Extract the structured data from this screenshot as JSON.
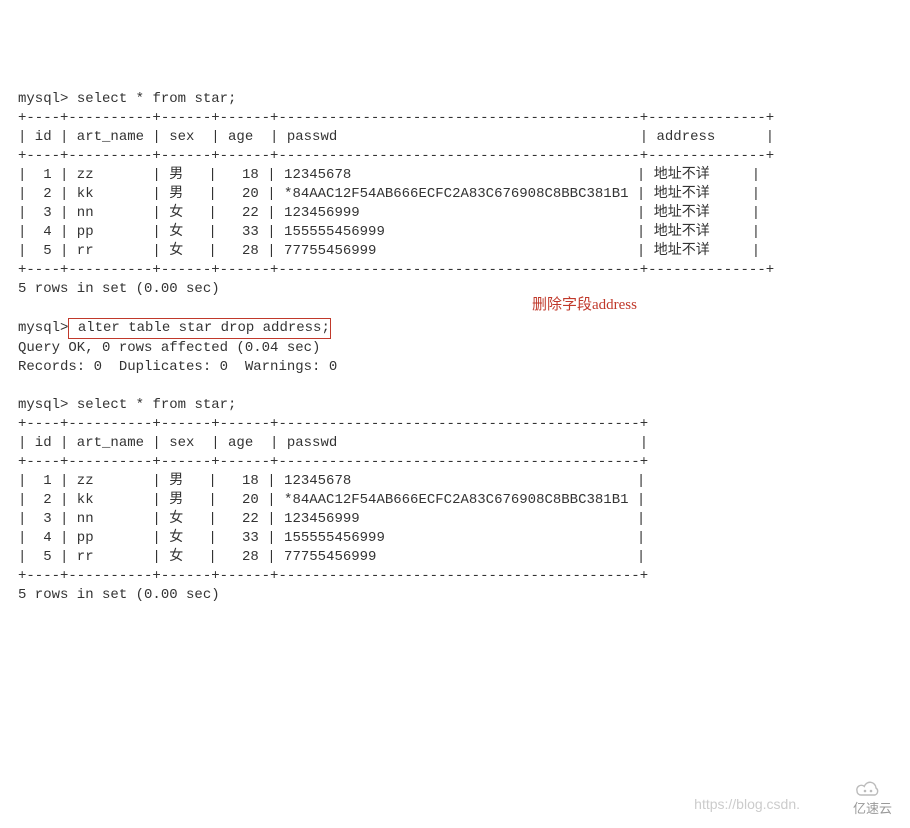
{
  "query1": {
    "prompt": "mysql>",
    "select": "select * from star;",
    "headers": [
      "id",
      "art_name",
      "sex",
      "age",
      "passwd",
      "address"
    ],
    "border_top": "+----+----------+------+------+-------------------------------------------+--------------+",
    "header_line": "| id | art_name | sex  | age  | passwd                                    | address      |",
    "border_mid": "+----+----------+------+------+-------------------------------------------+--------------+",
    "rows": [
      "|  1 | zz       | 男   |   18 | 12345678                                  | 地址不详     |",
      "|  2 | kk       | 男   |   20 | *84AAC12F54AB666ECFC2A83C676908C8BBC381B1 | 地址不详     |",
      "|  3 | nn       | 女   |   22 | 123456999                                 | 地址不详     |",
      "|  4 | pp       | 女   |   33 | 155555456999                              | 地址不详     |",
      "|  5 | rr       | 女   |   28 | 77755456999                               | 地址不详     |"
    ],
    "border_bot": "+----+----------+------+------+-------------------------------------------+--------------+",
    "footer": "5 rows in set (0.00 sec)"
  },
  "alter": {
    "prompt": "mysql>",
    "stmt_pre": " alter table star drop address;",
    "result1": "Query OK, 0 rows affected (0.04 sec)",
    "result2": "Records: 0  Duplicates: 0  Warnings: 0"
  },
  "annotation": {
    "text": "删除字段address"
  },
  "query2": {
    "prompt": "mysql>",
    "select": "select * from star;",
    "headers": [
      "id",
      "art_name",
      "sex",
      "age",
      "passwd"
    ],
    "border_top": "+----+----------+------+------+-------------------------------------------+",
    "header_line": "| id | art_name | sex  | age  | passwd                                    |",
    "border_mid": "+----+----------+------+------+-------------------------------------------+",
    "rows": [
      "|  1 | zz       | 男   |   18 | 12345678                                  |",
      "|  2 | kk       | 男   |   20 | *84AAC12F54AB666ECFC2A83C676908C8BBC381B1 |",
      "|  3 | nn       | 女   |   22 | 123456999                                 |",
      "|  4 | pp       | 女   |   33 | 155555456999                              |",
      "|  5 | rr       | 女   |   28 | 77755456999                               |"
    ],
    "border_bot": "+----+----------+------+------+-------------------------------------------+",
    "footer": "5 rows in set (0.00 sec)"
  },
  "watermark": {
    "text": "https://blog.csdn."
  },
  "logo": {
    "text": "亿速云"
  },
  "chart_data": {
    "type": "table",
    "title": "star table before and after dropping address column",
    "before": {
      "columns": [
        "id",
        "art_name",
        "sex",
        "age",
        "passwd",
        "address"
      ],
      "rows": [
        {
          "id": 1,
          "art_name": "zz",
          "sex": "男",
          "age": 18,
          "passwd": "12345678",
          "address": "地址不详"
        },
        {
          "id": 2,
          "art_name": "kk",
          "sex": "男",
          "age": 20,
          "passwd": "*84AAC12F54AB666ECFC2A83C676908C8BBC381B1",
          "address": "地址不详"
        },
        {
          "id": 3,
          "art_name": "nn",
          "sex": "女",
          "age": 22,
          "passwd": "123456999",
          "address": "地址不详"
        },
        {
          "id": 4,
          "art_name": "pp",
          "sex": "女",
          "age": 33,
          "passwd": "155555456999",
          "address": "地址不详"
        },
        {
          "id": 5,
          "art_name": "rr",
          "sex": "女",
          "age": 28,
          "passwd": "77755456999",
          "address": "地址不详"
        }
      ]
    },
    "ddl": "alter table star drop address;",
    "after": {
      "columns": [
        "id",
        "art_name",
        "sex",
        "age",
        "passwd"
      ],
      "rows": [
        {
          "id": 1,
          "art_name": "zz",
          "sex": "男",
          "age": 18,
          "passwd": "12345678"
        },
        {
          "id": 2,
          "art_name": "kk",
          "sex": "男",
          "age": 20,
          "passwd": "*84AAC12F54AB666ECFC2A83C676908C8BBC381B1"
        },
        {
          "id": 3,
          "art_name": "nn",
          "sex": "女",
          "age": 22,
          "passwd": "123456999"
        },
        {
          "id": 4,
          "art_name": "pp",
          "sex": "女",
          "age": 33,
          "passwd": "155555456999"
        },
        {
          "id": 5,
          "art_name": "rr",
          "sex": "女",
          "age": 28,
          "passwd": "77755456999"
        }
      ]
    }
  }
}
